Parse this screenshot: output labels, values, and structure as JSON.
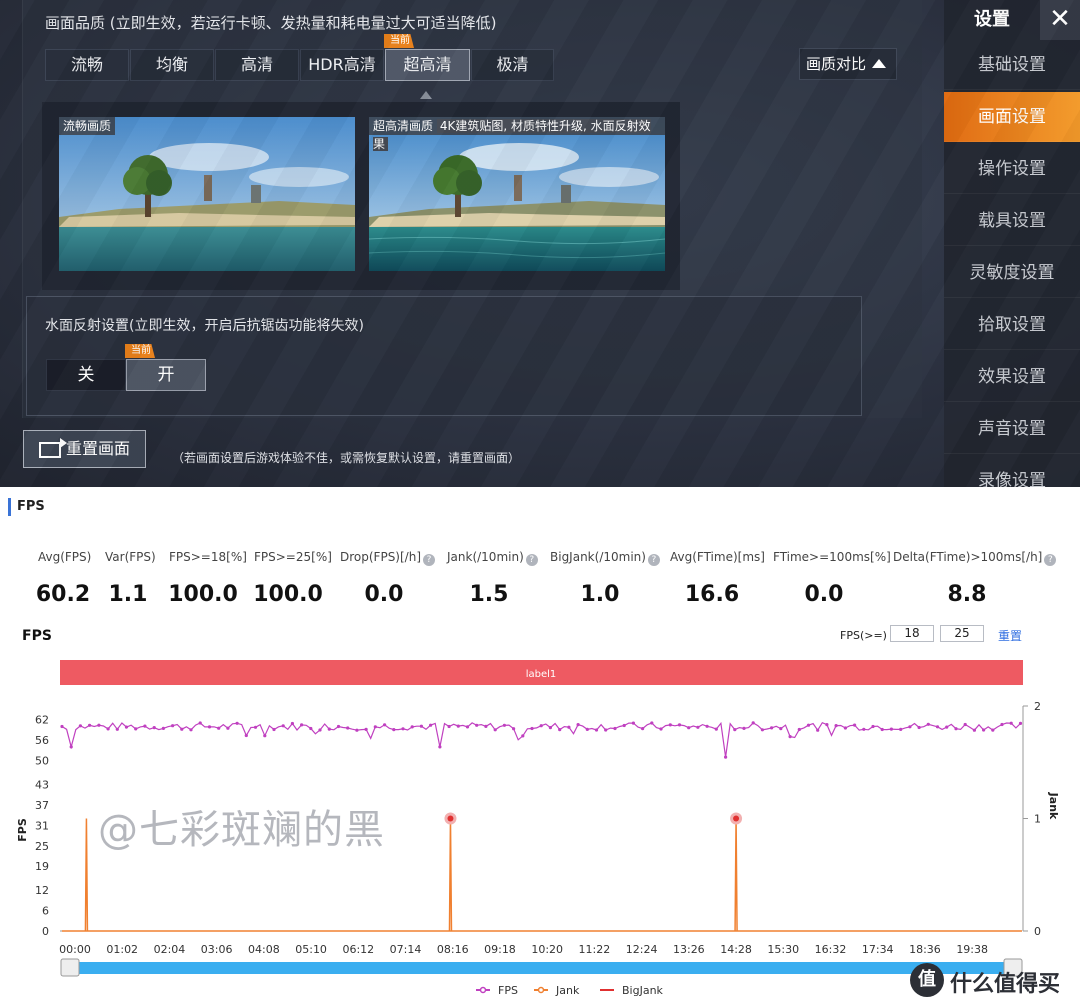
{
  "game": {
    "quality": {
      "label": "画面品质 (立即生效，若运行卡顿、发热量和耗电量过大可适当降低)",
      "options": [
        "流畅",
        "均衡",
        "高清",
        "HDR高清",
        "超高清",
        "极清"
      ],
      "current_badge": "当前",
      "compare_button": "画质对比"
    },
    "preview": {
      "left_caption": "流畅画质",
      "right_caption_a": "超高清画质",
      "right_caption_b": "4K建筑贴图, 材质特性升级, 水面反射效果"
    },
    "water": {
      "label": "水面反射设置(立即生效，开启后抗锯齿功能将失效)",
      "off": "关",
      "on": "开",
      "current_badge": "当前"
    },
    "reset": {
      "button": "重置画面",
      "hint": "（若画面设置后游戏体验不佳，或需恢复默认设置，请重置画面）"
    },
    "sidebar": {
      "title": "设置",
      "close": "✕",
      "items": [
        "基础设置",
        "画面设置",
        "操作设置",
        "载具设置",
        "灵敏度设置",
        "拾取设置",
        "效果设置",
        "声音设置",
        "录像设置"
      ]
    }
  },
  "fps": {
    "section_title": "FPS",
    "stats": [
      {
        "label": "Avg(FPS)",
        "value": "60.2",
        "help": false
      },
      {
        "label": "Var(FPS)",
        "value": "1.1",
        "help": false
      },
      {
        "label": "FPS>=18[%]",
        "value": "100.0",
        "help": false
      },
      {
        "label": "FPS>=25[%]",
        "value": "100.0",
        "help": false
      },
      {
        "label": "Drop(FPS)[/h]",
        "value": "0.0",
        "help": true
      },
      {
        "label": "Jank(/10min)",
        "value": "1.5",
        "help": true
      },
      {
        "label": "BigJank(/10min)",
        "value": "1.0",
        "help": true
      },
      {
        "label": "Avg(FTime)[ms]",
        "value": "16.6",
        "help": false
      },
      {
        "label": "FTime>=100ms[%]",
        "value": "0.0",
        "help": false
      },
      {
        "label": "Delta(FTime)>100ms[/h]",
        "value": "8.8",
        "help": true
      }
    ],
    "chart_title": "FPS",
    "threshold_label": "FPS(>=)",
    "threshold_values": [
      "18",
      "25"
    ],
    "reset_link": "重置",
    "watermark": "@七彩斑斓的黑",
    "logo_mark": "值",
    "logo_text": "什么值得买"
  },
  "chart_data": {
    "type": "line",
    "band_label": "label1",
    "ylabel": "FPS",
    "y2label": "Jank",
    "y_ticks": [
      0,
      6,
      12,
      19,
      25,
      31,
      37,
      43,
      50,
      56,
      62
    ],
    "y2_ticks": [
      0,
      1,
      2
    ],
    "ylim": [
      0,
      66
    ],
    "y2lim": [
      0,
      2
    ],
    "x_ticks": [
      "00:00",
      "01:02",
      "02:04",
      "03:06",
      "04:08",
      "05:10",
      "06:12",
      "07:14",
      "08:16",
      "09:18",
      "10:20",
      "11:22",
      "12:24",
      "13:26",
      "14:28",
      "15:30",
      "16:32",
      "17:34",
      "18:36",
      "19:38"
    ],
    "series": [
      {
        "name": "FPS",
        "color": "#c040c0",
        "baseline": 60,
        "dips": [
          {
            "x": "00:10",
            "y": 54
          },
          {
            "x": "08:10",
            "y": 54
          },
          {
            "x": "14:25",
            "y": 51
          }
        ]
      },
      {
        "name": "Jank",
        "color": "#f08030",
        "spikes": [
          {
            "x": "00:15",
            "y": 1
          },
          {
            "x": "08:13",
            "y": 1
          },
          {
            "x": "14:28",
            "y": 1
          }
        ]
      },
      {
        "name": "BigJank",
        "color": "#e03030",
        "points": [
          {
            "x": "08:13",
            "y": 1
          },
          {
            "x": "14:28",
            "y": 1
          }
        ]
      }
    ],
    "legend": [
      "FPS",
      "Jank",
      "BigJank"
    ],
    "legend_position": "bottom",
    "grid": false
  }
}
